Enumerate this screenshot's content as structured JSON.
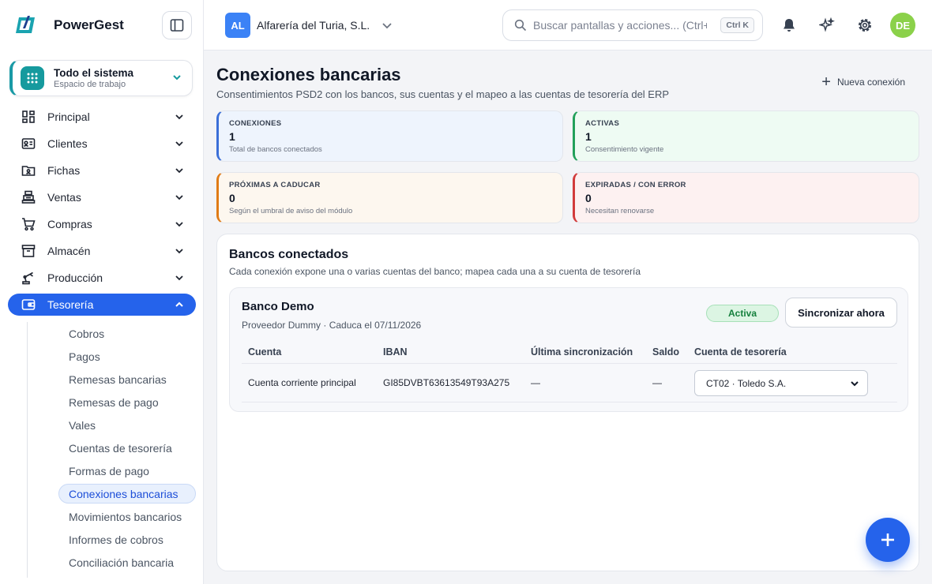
{
  "app": {
    "name": "PowerGest"
  },
  "workspace": {
    "title": "Todo el sistema",
    "subtitle": "Espacio de trabajo"
  },
  "sidebar": {
    "items": [
      {
        "label": "Principal",
        "icon": "dashboard-icon"
      },
      {
        "label": "Clientes",
        "icon": "contact-card-icon"
      },
      {
        "label": "Fichas",
        "icon": "folder-user-icon"
      },
      {
        "label": "Ventas",
        "icon": "cash-register-icon"
      },
      {
        "label": "Compras",
        "icon": "cart-icon"
      },
      {
        "label": "Almacén",
        "icon": "archive-box-icon"
      },
      {
        "label": "Producción",
        "icon": "robot-arm-icon"
      },
      {
        "label": "Tesorería",
        "icon": "wallet-icon",
        "active": true
      }
    ],
    "sub_items": [
      "Cobros",
      "Pagos",
      "Remesas bancarias",
      "Remesas de pago",
      "Vales",
      "Cuentas de tesorería",
      "Formas de pago",
      "Conexiones bancarias",
      "Movimientos bancarios",
      "Informes de cobros",
      "Conciliación bancaria"
    ],
    "active_sub_item": "Conexiones bancarias"
  },
  "topbar": {
    "company_initials": "AL",
    "company_name": "Alfarería del Turia, S.L.",
    "search_placeholder": "Buscar pantallas y acciones... (Ctrl+K)",
    "search_shortcut": "Ctrl K",
    "user_initials": "DE"
  },
  "page": {
    "title": "Conexiones bancarias",
    "subtitle": "Consentimientos PSD2 con los bancos, sus cuentas y el mapeo a las cuentas de tesorería del ERP",
    "new_connection_label": "Nueva conexión"
  },
  "stats": [
    {
      "key": "CONEXIONES",
      "value": "1",
      "desc": "Total de bancos conectados"
    },
    {
      "key": "ACTIVAS",
      "value": "1",
      "desc": "Consentimiento vigente"
    },
    {
      "key": "PRÓXIMAS A CADUCAR",
      "value": "0",
      "desc": "Según el umbral de aviso del módulo"
    },
    {
      "key": "EXPIRADAS / CON ERROR",
      "value": "0",
      "desc": "Necesitan renovarse"
    }
  ],
  "panel": {
    "title": "Bancos conectados",
    "subtitle": "Cada conexión expone una o varias cuentas del banco; mapea cada una a su cuenta de tesorería"
  },
  "bank": {
    "name": "Banco Demo",
    "meta": "Proveedor Dummy · Caduca el 07/11/2026",
    "status": "Activa",
    "sync_label": "Sincronizar ahora",
    "columns": [
      "Cuenta",
      "IBAN",
      "Última sincronización",
      "Saldo",
      "Cuenta de tesorería"
    ],
    "rows": [
      {
        "account": "Cuenta corriente principal",
        "iban": "GI85DVBT63613549T93A275",
        "last_sync": "—",
        "balance": "—",
        "treasury": "CT02 · Toledo S.A."
      }
    ]
  },
  "colors": {
    "accent": "#2563eb",
    "teal": "#169a9e",
    "success": "#15803d",
    "avatar": "#8bd14a"
  }
}
